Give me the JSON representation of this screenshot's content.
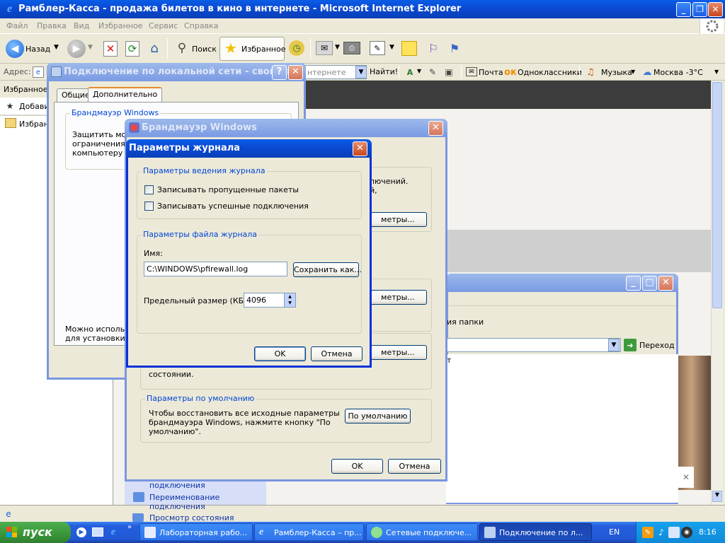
{
  "ie": {
    "title": "Рамблер-Касса - продажа билетов в кино в интернете - Microsoft Internet Explorer",
    "menu": [
      "Файл",
      "Правка",
      "Вид",
      "Избранное",
      "Сервис",
      "Справка"
    ],
    "toolbar": {
      "back": "Назад",
      "search": "Поиск",
      "favorites": "Избранное"
    },
    "address_label": "Адрес:",
    "address_partial": "нтернете",
    "go_label": "Найти!",
    "links": {
      "mail": "Почта",
      "ok": "Одноклассники",
      "music": "Музыка",
      "weather": "Москва -3°C"
    },
    "favorites_pane": {
      "title": "Избранное",
      "add": "Добави",
      "folder": "Избранн"
    }
  },
  "conn_props": {
    "title": "Подключение по локальной сети - свойства",
    "tabs": [
      "Общие",
      "Дополнительно"
    ],
    "fw_group": "Брандмауэр Windows",
    "fw_text_lines": [
      "Защитить мой",
      "ограничения и",
      "компьютеру че"
    ],
    "bottom_lines": [
      "Можно использо",
      "для установки эт"
    ]
  },
  "firewall": {
    "title": "Брандмауэр Windows",
    "right_text_1": [
      "лючений.",
      "й,"
    ],
    "param_btn": "метры...",
    "bottom_snip": [
      "состоянии."
    ],
    "defaults_group": "Параметры по умолчанию",
    "defaults_text": [
      "Чтобы восстановить все исходные параметры",
      "брандмауэра Windows, нажмите кнопку \"По",
      "умолчанию\"."
    ],
    "defaults_btn": "По умолчанию",
    "ok": "OK",
    "cancel": "Отмена"
  },
  "log_dialog": {
    "title": "Параметры журнала",
    "group1": "Параметры ведения журнала",
    "chk1": "Записывать пропущенные пакеты",
    "chk2": "Записывать успешные подключения",
    "group2": "Параметры файла журнала",
    "name_label": "Имя:",
    "path": "C:\\WINDOWS\\pfirewall.log",
    "save_as": "Сохранить как...",
    "size_label": "Предельный размер (КБ):",
    "size_value": "4096",
    "ok": "OK",
    "cancel": "Отмена"
  },
  "net_conn": {
    "folder_text": "ия папки",
    "go": "Переход",
    "partial": "т",
    "tasks": [
      "подключения",
      "Переименование",
      "подключения",
      "Просмотр состояния"
    ]
  },
  "taskbar": {
    "start": "пуск",
    "items": [
      "Лабораторная рабо...",
      "Рамблер-Касса – пр...",
      "Сетевые подключе...",
      "Подключение по л..."
    ],
    "lang": "EN",
    "clock": "8:16"
  },
  "colors": {
    "xp_blue": "#0a5de6",
    "link_blue": "#0046d5",
    "task_green": "#3c9a3c"
  }
}
